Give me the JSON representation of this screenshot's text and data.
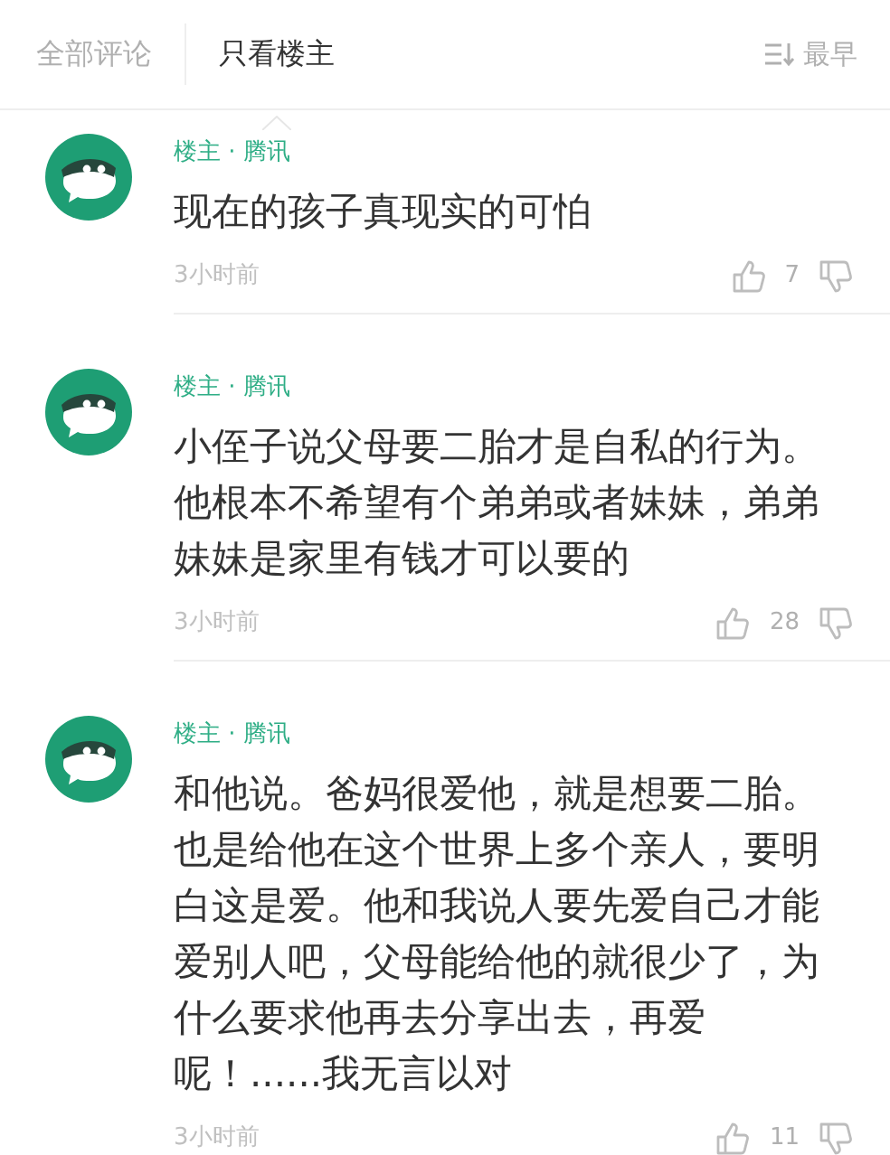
{
  "tabs": [
    {
      "label": "全部评论",
      "selected": false
    },
    {
      "label": "只看楼主",
      "selected": true
    }
  ],
  "sort": {
    "label": "最早"
  },
  "comments": [
    {
      "author": "楼主 · 腾讯",
      "text": "现在的孩子真现实的可怕",
      "time": "3小时前",
      "likes": "7"
    },
    {
      "author": "楼主 · 腾讯",
      "text": "小侄子说父母要二胎才是自私的行为。他根本不希望有个弟弟或者妹妹，弟弟妹妹是家里有钱才可以要的",
      "time": "3小时前",
      "likes": "28"
    },
    {
      "author": "楼主 · 腾讯",
      "text": "和他说。爸妈很爱他，就是想要二胎。也是给他在这个世界上多个亲人，要明白这是爱。他和我说人要先爱自己才能爱别人吧，父母能给他的就很少了，为什么要求他再去分享出去，再爱呢！......我无言以对",
      "time": "3小时前",
      "likes": "11"
    }
  ]
}
